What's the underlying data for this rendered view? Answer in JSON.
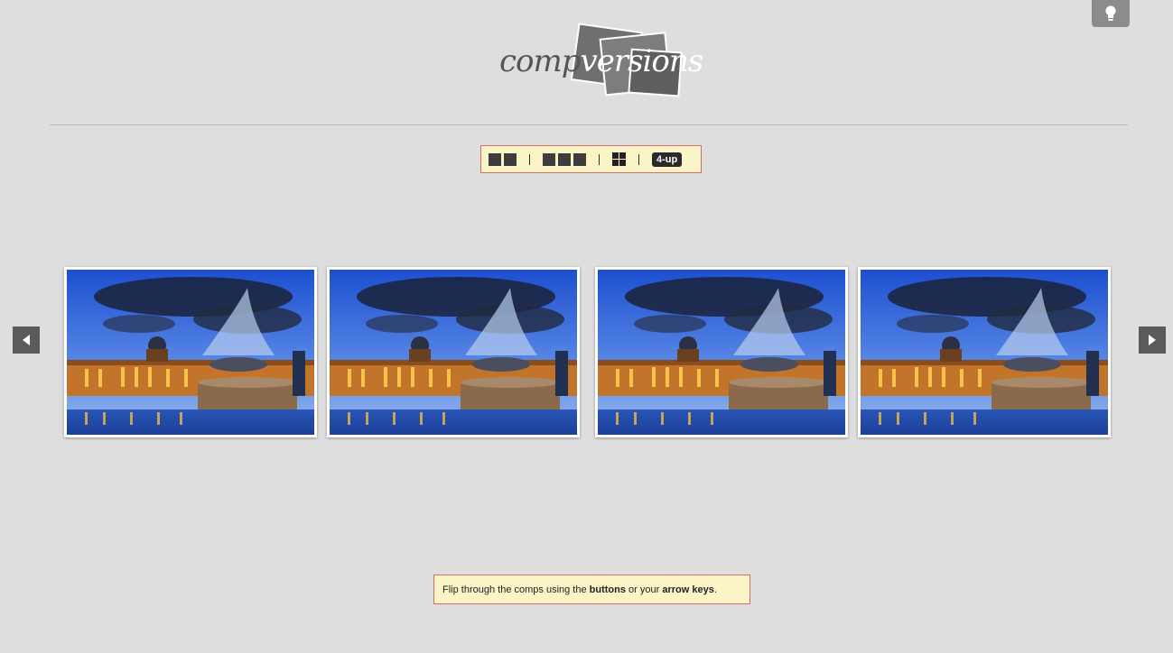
{
  "app": {
    "logo_part1": "comp",
    "logo_part2": "versions"
  },
  "toolbar": {
    "layouts": [
      {
        "name": "2-up",
        "icon": "two-squares-icon"
      },
      {
        "name": "3-up",
        "icon": "three-squares-icon"
      },
      {
        "name": "grid",
        "icon": "grid-icon"
      },
      {
        "name": "4-up",
        "label": "4-up"
      }
    ],
    "active_label": "4-up"
  },
  "comps": [
    {
      "icon": "trafalgar-square-photo"
    },
    {
      "icon": "trafalgar-square-photo"
    },
    {
      "icon": "trafalgar-square-photo"
    },
    {
      "icon": "trafalgar-square-photo"
    }
  ],
  "hint": {
    "prefix": "Flip through the comps using the ",
    "buttons": "buttons",
    "middle": " or your ",
    "arrow_keys": "arrow keys",
    "suffix": "."
  },
  "colors": {
    "background": "#dededf",
    "toolbar_bg": "#fbf4c7",
    "toolbar_border": "#d46a6a",
    "arrow_bg": "#5b5b5b"
  }
}
